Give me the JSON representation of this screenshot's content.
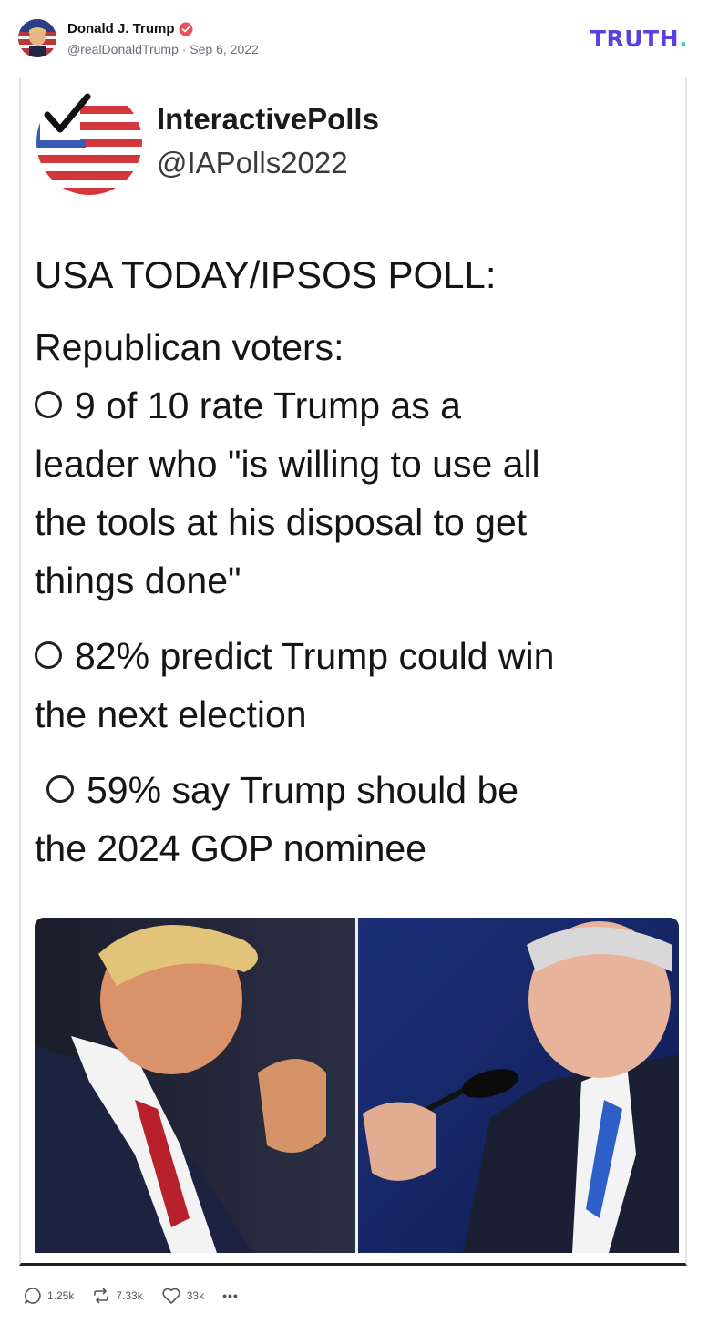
{
  "post": {
    "author_name": "Donald J. Trump",
    "handle_date": "@realDonaldTrump · Sep 6, 2022",
    "brand": "TRUTH",
    "brand_dot": "."
  },
  "media": {
    "account_name": "InteractivePolls",
    "account_handle": "@IAPolls2022",
    "title": "USA TODAY/IPSOS POLL:",
    "subtitle": "Republican voters:",
    "bullets": [
      {
        "lines": [
          "9 of 10 rate Trump as a",
          "leader who \"is willing to use all",
          "the tools at his disposal to get",
          "things done\""
        ]
      },
      {
        "lines": [
          "82% predict Trump could win",
          "the next election"
        ]
      },
      {
        "lines": [
          "59% say Trump should be",
          "the 2024 GOP nominee"
        ]
      }
    ]
  },
  "actions": {
    "replies": "1.25k",
    "retruths": "7.33k",
    "likes": "33k",
    "more": "•••"
  },
  "colors": {
    "brand_purple": "#5b3fe0",
    "brand_teal": "#2fd3b4",
    "verified": "#e8525a",
    "flag_red": "#d3373b",
    "flag_blue": "#3a5bb3"
  }
}
